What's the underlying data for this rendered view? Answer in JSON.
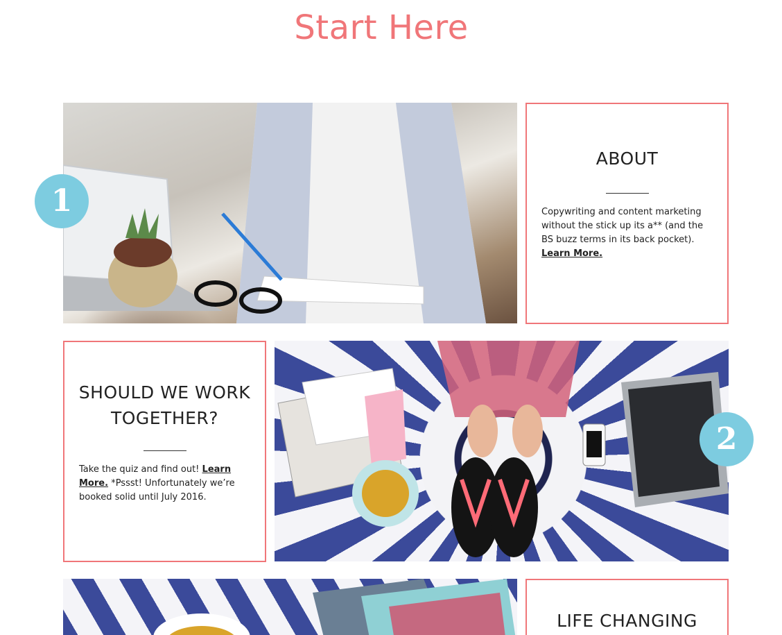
{
  "page": {
    "title": "Start Here"
  },
  "colors": {
    "accent": "#f07679",
    "badge": "#7dcce0",
    "text": "#222222"
  },
  "about": {
    "heading": "ABOUT",
    "body_text": "Copywriting and content marketing without the stick up its a** (and the BS buzz terms in its back pocket).",
    "link_label": "Learn More."
  },
  "work": {
    "heading": "SHOULD WE WORK TOGETHER?",
    "body_prefix": "Take the quiz and find out!",
    "link_label": "Learn More.",
    "body_suffix": "*Pssst! Unfortunately we’re booked solid until July 2016."
  },
  "life": {
    "heading": "LIFE CHANGING"
  },
  "badges": {
    "one": "1",
    "two": "2"
  },
  "photos": {
    "photo_1_icon": "woman-writing-at-desk-photo",
    "photo_2_icon": "flatlay-feet-laptop-tea-photo",
    "photo_3_icon": "tea-magazines-photo"
  }
}
